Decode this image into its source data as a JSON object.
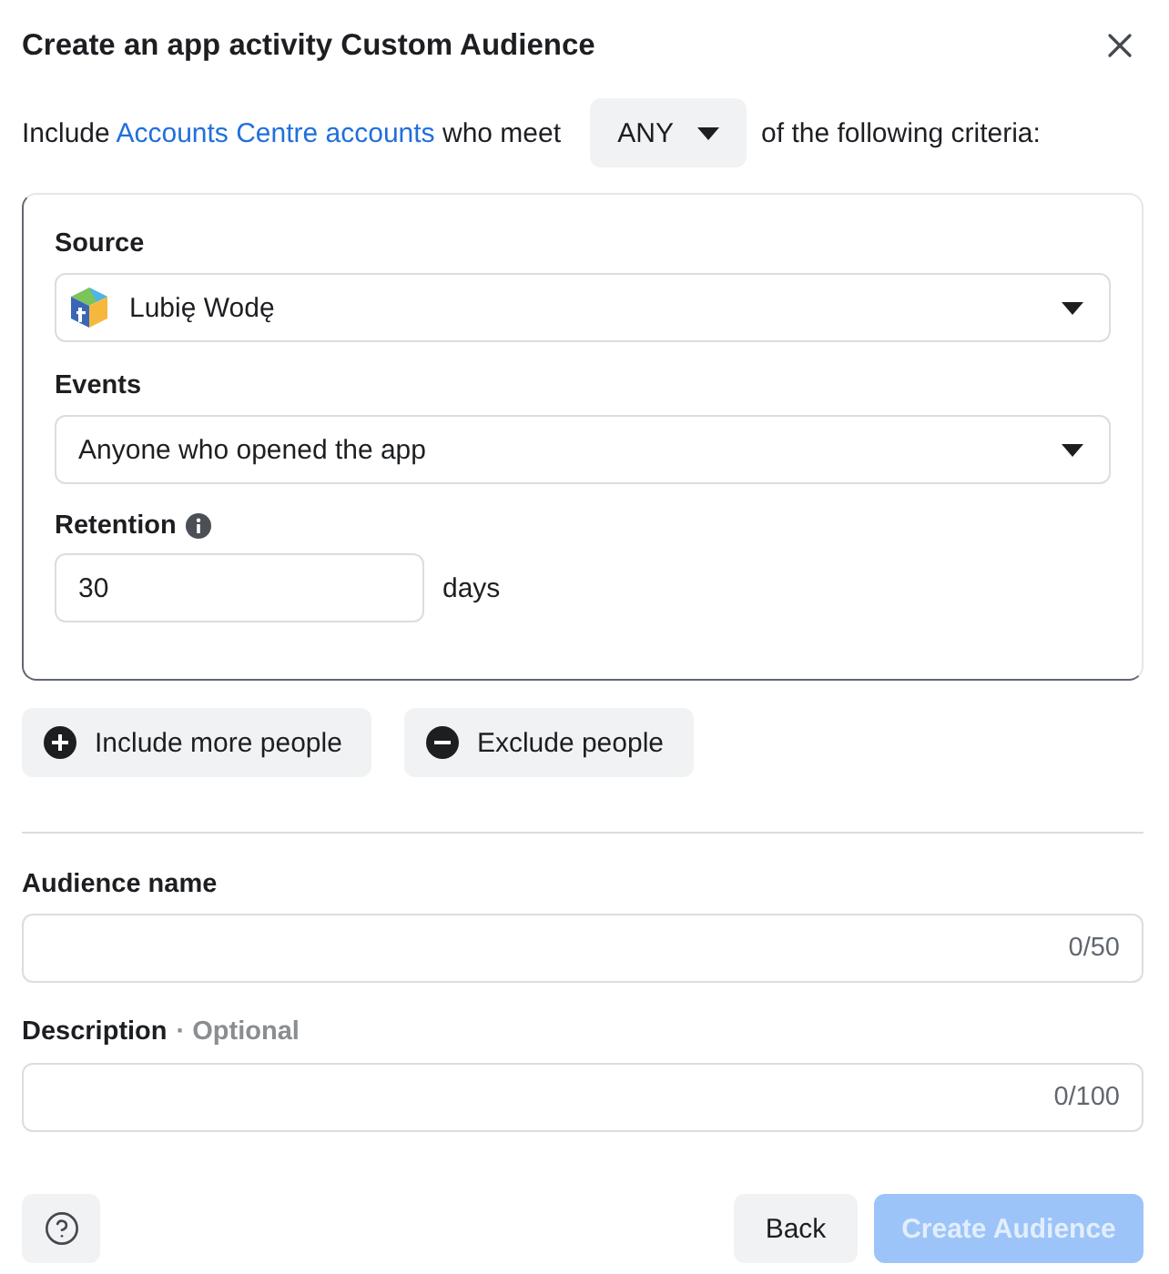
{
  "dialog": {
    "title": "Create an app activity Custom Audience"
  },
  "intro": {
    "lead": "Include",
    "link": "Accounts Centre accounts",
    "after_link": "who meet",
    "match": "ANY",
    "trail": "of the following criteria:"
  },
  "criteria": {
    "source": {
      "label": "Source",
      "value": "Lubię Wodę"
    },
    "events": {
      "label": "Events",
      "value": "Anyone who opened the app"
    },
    "retention": {
      "label": "Retention",
      "value": "30",
      "unit": "days"
    }
  },
  "actions": [
    {
      "kind": "include",
      "label": "Include more people"
    },
    {
      "kind": "exclude",
      "label": "Exclude people"
    }
  ],
  "fields": [
    {
      "label": "Audience name",
      "counter": "0/50"
    },
    {
      "label": "Description",
      "note": "· Optional",
      "counter": "0/100"
    }
  ],
  "footer": {
    "back": "Back",
    "create": {
      "label": "Create Audience",
      "disabled": true
    }
  }
}
